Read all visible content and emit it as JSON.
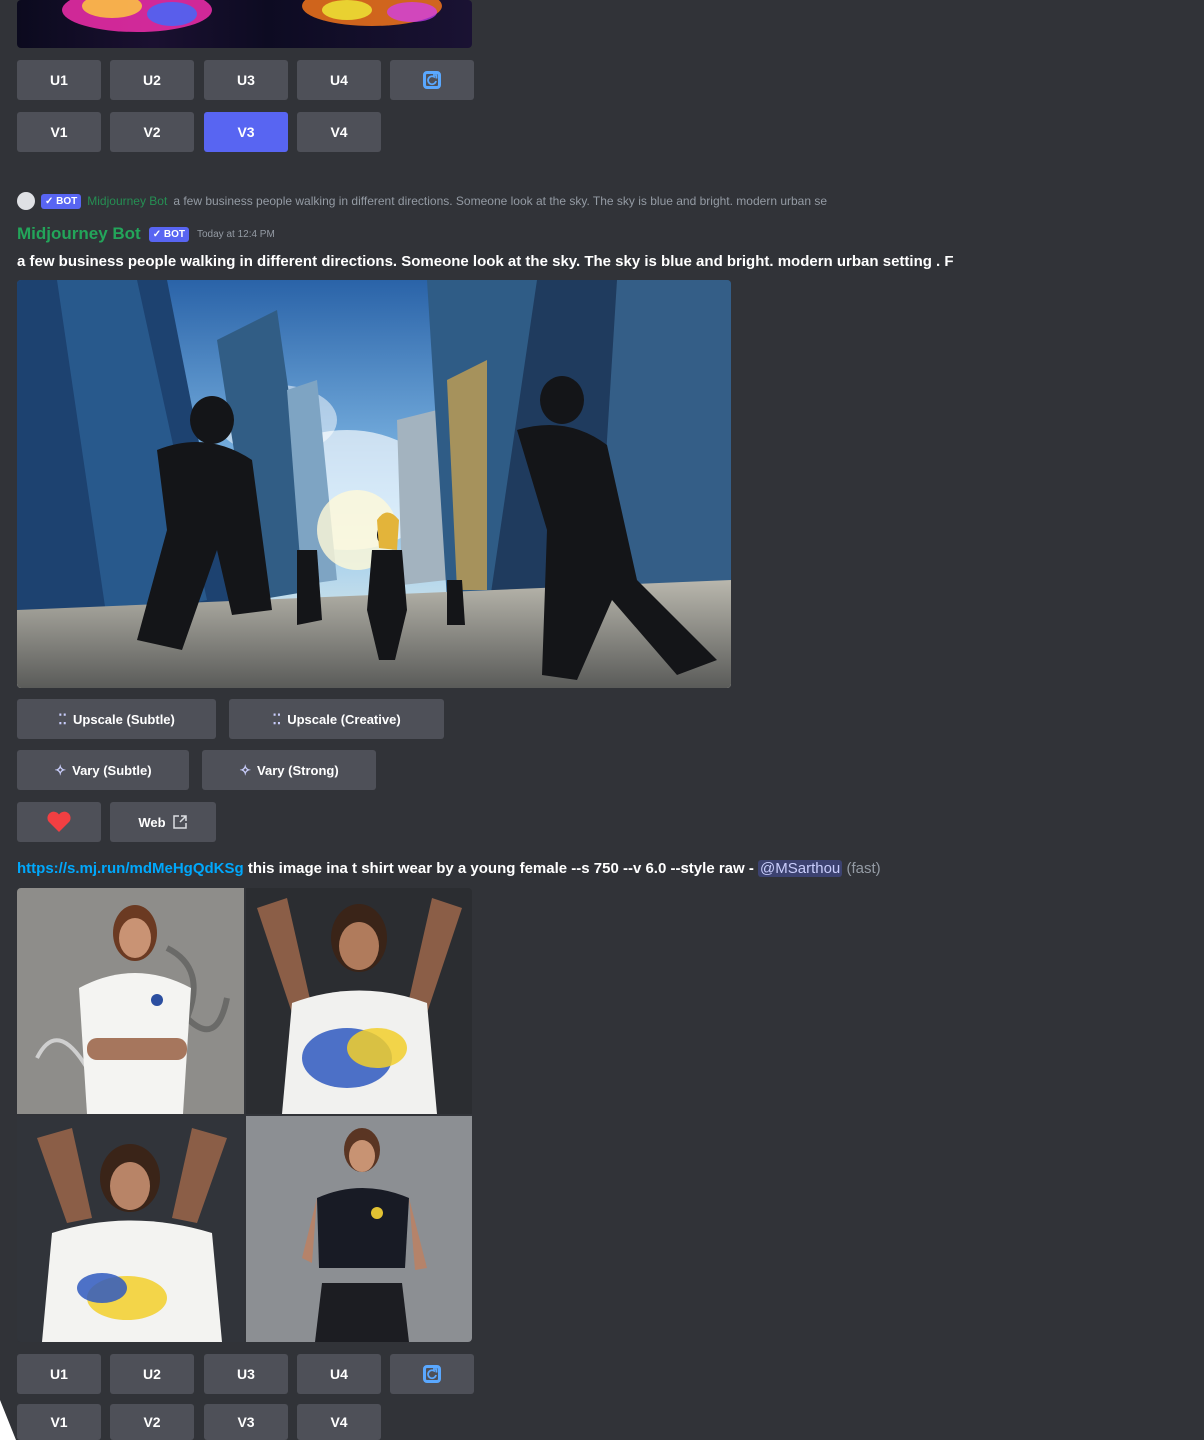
{
  "grid_buttons_top": {
    "upscale": [
      "U1",
      "U2",
      "U3",
      "U4"
    ],
    "variation": [
      "V1",
      "V2",
      "V3",
      "V4"
    ],
    "active_variation": "V3",
    "refresh_icon": "refresh-icon"
  },
  "reply_preview": {
    "bot_tag": "✓ BOT",
    "author": "Midjourney Bot",
    "text": "a few business people walking in different directions. Someone look at the sky. The sky is blue and bright. modern urban se"
  },
  "message_header": {
    "author": "Midjourney Bot",
    "bot_tag": "✓ BOT",
    "timestamp": "Today at 12:4 PM"
  },
  "message_prompt": "a few business people walking in different directions. Someone look at the sky. The sky is blue and bright. modern urban setting . F",
  "actions": {
    "upscale_subtle": "Upscale (Subtle)",
    "upscale_creative": "Upscale (Creative)",
    "vary_subtle": "Vary (Subtle)",
    "vary_strong": "Vary (Strong)",
    "web": "Web",
    "heart_icon": "heart-icon",
    "external_icon": "external-link-icon"
  },
  "second_message": {
    "link": "https://s.mj.run/mdMeHgQdKSg",
    "prompt": " this image ina t shirt wear by a young female --s 750 --v 6.0 --style raw - ",
    "mention": "@MSarthou",
    "suffix": " (fast)"
  },
  "grid_buttons_bottom": {
    "upscale": [
      "U1",
      "U2",
      "U3",
      "U4"
    ],
    "variation": [
      "V1",
      "V2",
      "V3",
      "V4"
    ]
  },
  "colors": {
    "background": "#313338",
    "button": "#4e5058",
    "blurple": "#5865f2",
    "bot_name": "#23a55a",
    "link": "#00a8fc"
  }
}
